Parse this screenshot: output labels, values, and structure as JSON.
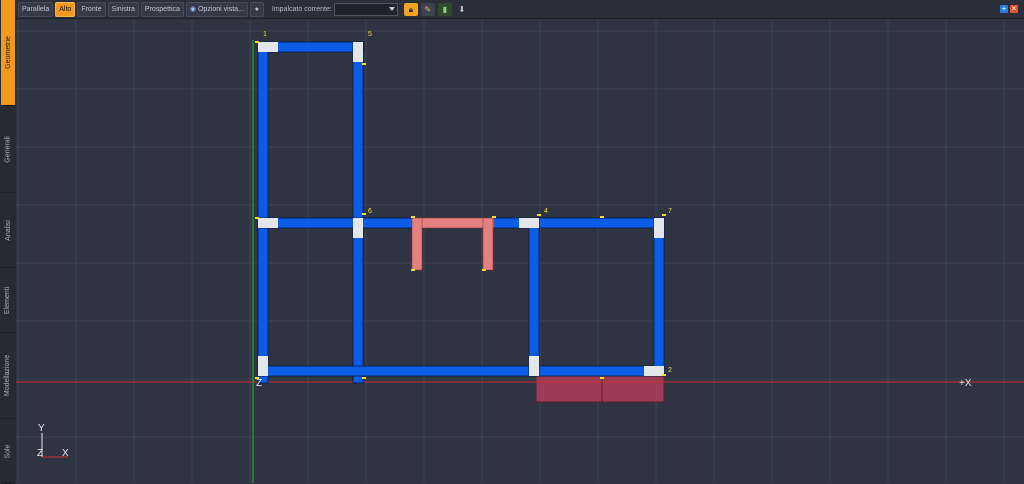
{
  "sidebar": {
    "tabs": [
      {
        "label": "Geometrie",
        "active": true
      },
      {
        "label": "Generali",
        "active": false
      },
      {
        "label": "Analisi",
        "active": false
      },
      {
        "label": "Elementi",
        "active": false
      },
      {
        "label": "Modellazione",
        "active": false
      },
      {
        "label": "Sole",
        "active": false
      }
    ]
  },
  "toolbar": {
    "view_buttons": [
      {
        "label": "Parallela",
        "active": false
      },
      {
        "label": "Alto",
        "active": true
      },
      {
        "label": "Fronte",
        "active": false
      },
      {
        "label": "Sinistra",
        "active": false
      },
      {
        "label": "Prospettica",
        "active": false
      }
    ],
    "view_options_label": "Opzioni vista...",
    "floor_label": "Impalcato corrente:",
    "floor_value": "",
    "icons": [
      "lock-icon",
      "wrench-icon",
      "trash-icon",
      "pin-icon"
    ]
  },
  "viewport": {
    "colors": {
      "background": "#2e3441",
      "grid": "#4a5261",
      "wall": "#0b5de8",
      "beam": "#e58080",
      "slab": "#9c3b55",
      "node": "#e3e6ea",
      "x_axis": "#c8302e",
      "y_axis": "#1fbf2b"
    },
    "node_labels": [
      "1",
      "5",
      "6",
      "4",
      "7",
      "2"
    ],
    "axis_labels": {
      "x": "+X",
      "origin": "Z"
    },
    "triad": {
      "y": "Y",
      "z": "Z",
      "x": "X"
    }
  }
}
